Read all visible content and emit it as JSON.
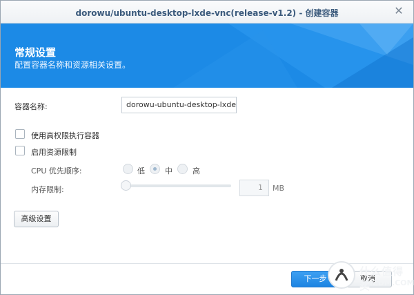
{
  "window": {
    "title": "dorowu/ubuntu-desktop-lxde-vnc(release-v1.2) - 创建容器",
    "close_glyph": "✕"
  },
  "banner": {
    "heading": "常规设置",
    "subtitle": "配置容器名称和资源相关设置。"
  },
  "form": {
    "container_name_label": "容器名称:",
    "container_name_value": "dorowu-ubuntu-desktop-lxde-vnc",
    "privileged_label": "使用高权限执行容器",
    "privileged_checked": false,
    "resource_limit_label": "启用资源限制",
    "resource_limit_checked": false,
    "cpu_priority": {
      "label": "CPU 优先顺序:",
      "options": [
        "低",
        "中",
        "高"
      ],
      "selected": "中"
    },
    "memory_limit": {
      "label": "内存限制:",
      "value": "1",
      "unit": "MB",
      "slider_fraction": 0
    }
  },
  "buttons": {
    "advanced": "高级设置",
    "next": "下一步",
    "cancel": "取消"
  },
  "watermark": {
    "title": "什么值得买",
    "subtitle": "SMZDM.COM"
  },
  "colors": {
    "banner": "#1c8ae6",
    "title": "#3b5a7c",
    "primary_button": "#1d84e2"
  }
}
